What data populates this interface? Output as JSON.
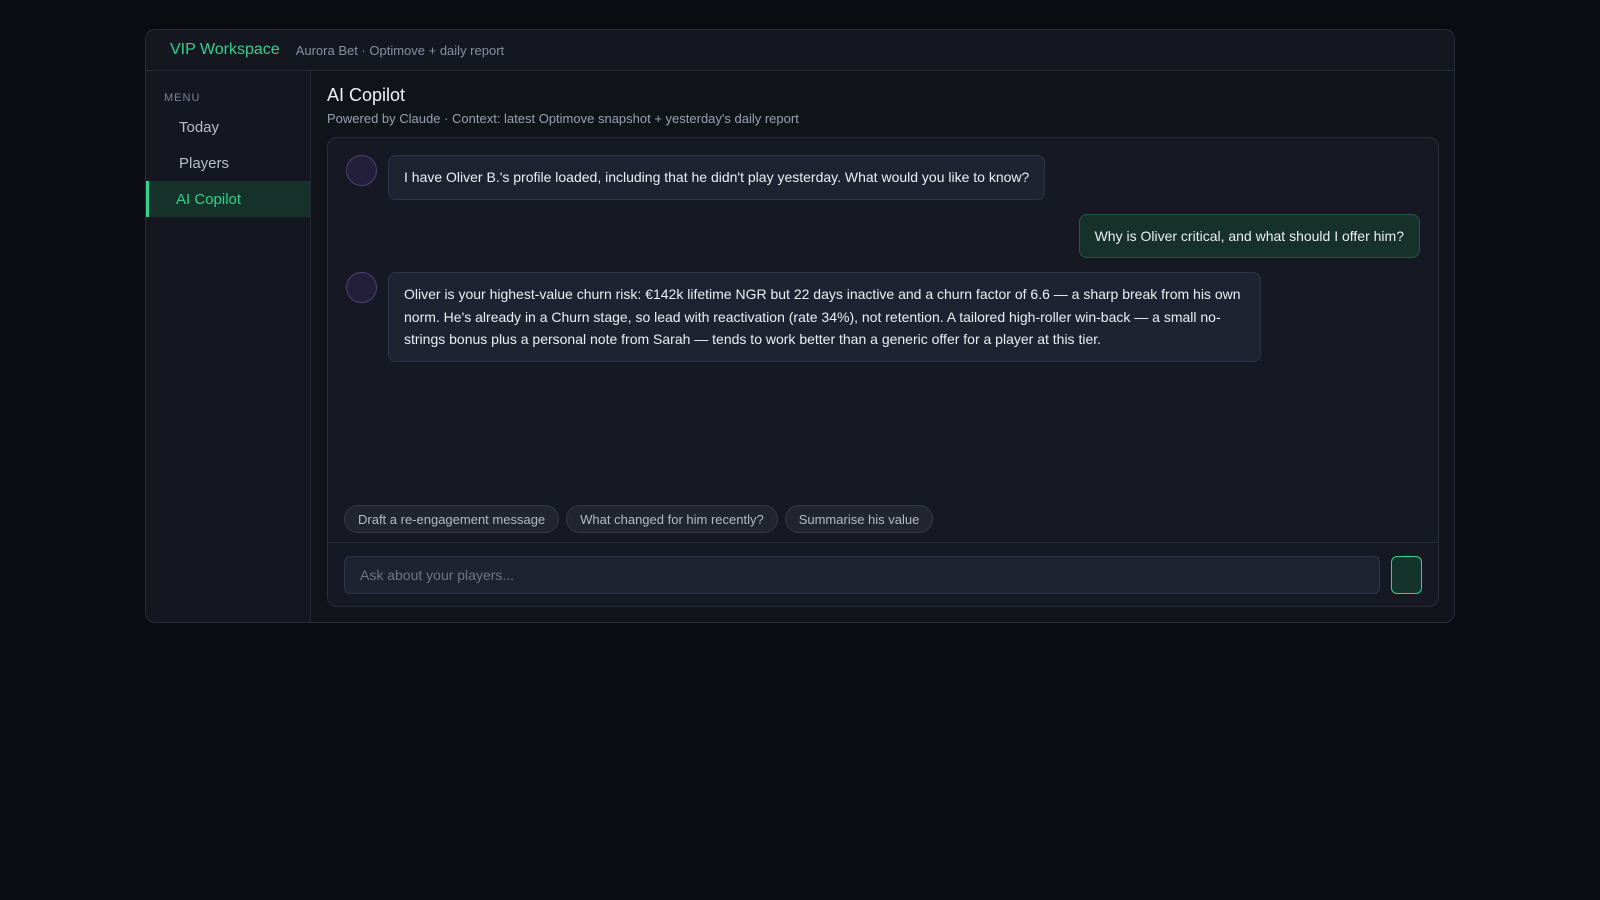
{
  "header": {
    "brand": "VIP Workspace",
    "org": "Aurora Bet · Optimove + daily report"
  },
  "sidebar": {
    "menu_label": "MENU",
    "items": [
      {
        "label": "Today",
        "active": false
      },
      {
        "label": "Players",
        "active": false
      },
      {
        "label": "AI Copilot",
        "active": true
      }
    ]
  },
  "main": {
    "title": "AI Copilot",
    "subtitle": "Powered by Claude · Context: latest Optimove snapshot + yesterday's daily report"
  },
  "chat": {
    "messages": [
      {
        "role": "assistant",
        "text": "I have Oliver B.'s profile loaded, including that he didn't play yesterday. What would you like to know?"
      },
      {
        "role": "user",
        "text": "Why is Oliver critical, and what should I offer him?"
      },
      {
        "role": "assistant",
        "text": "Oliver is your highest-value churn risk: €142k lifetime NGR but 22 days inactive and a churn factor of 6.6 — a sharp break from his own norm. He's already in a Churn stage, so lead with reactivation (rate 34%), not retention. A tailored high-roller win-back — a small no-strings bonus plus a personal note from Sarah — tends to work better than a generic offer for a player at this tier."
      }
    ],
    "suggestions": [
      "Draft a re-engagement message",
      "What changed for him recently?",
      "Summarise his value"
    ],
    "input": {
      "placeholder": "Ask about your players...",
      "value": ""
    }
  },
  "colors": {
    "accent": "#2fd38a",
    "background": "#0b0c12",
    "panel": "#161924"
  }
}
